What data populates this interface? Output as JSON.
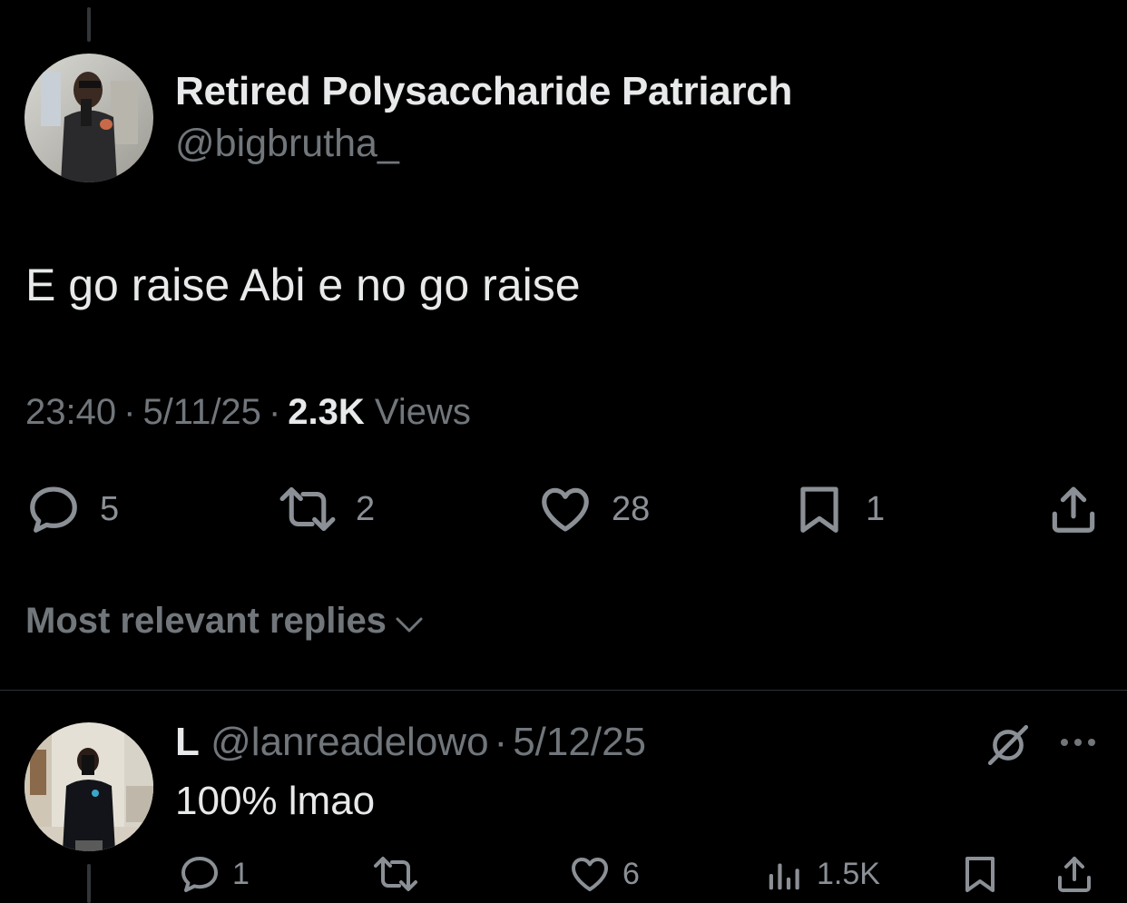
{
  "tweet": {
    "author_name": "Retired Polysaccharide Patriarch",
    "author_handle": "@bigbrutha_",
    "text": "E go raise Abi e no go raise",
    "time": "23:40",
    "date": "5/11/25",
    "views_count": "2.3K",
    "views_label": "Views",
    "separator": "·",
    "actions": {
      "replies": "5",
      "reposts": "2",
      "likes": "28",
      "bookmarks": "1"
    }
  },
  "replies_sort": {
    "label": "Most relevant replies",
    "icon": "chevron-down-icon"
  },
  "reply": {
    "author_name": "L",
    "author_handle": "@lanreadelowo",
    "separator": "·",
    "date": "5/12/25",
    "text": "100% lmao",
    "actions": {
      "replies": "1",
      "reposts": "",
      "likes": "6",
      "views": "1.5K"
    }
  },
  "colors": {
    "background": "#000000",
    "text_primary": "#e7e9ea",
    "text_secondary": "#71767b",
    "divider": "#2f3336"
  }
}
